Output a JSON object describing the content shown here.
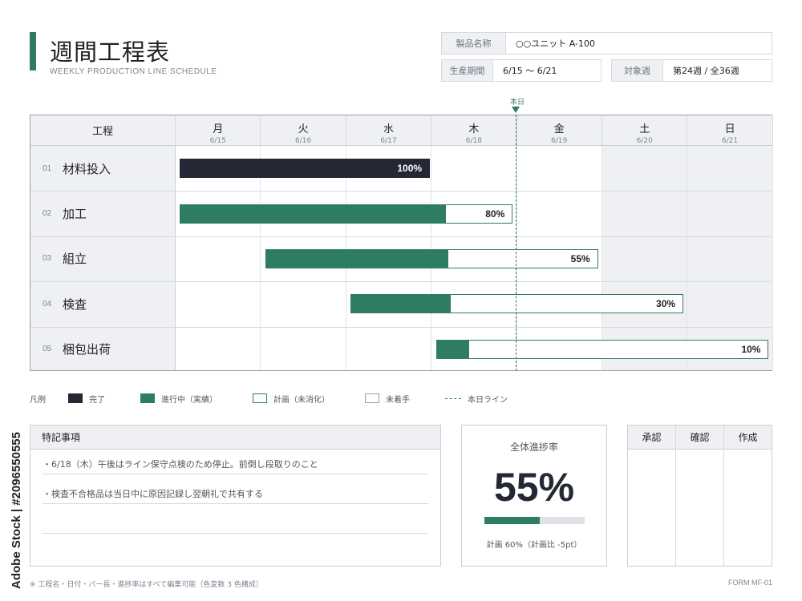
{
  "header": {
    "title": "週間工程表",
    "subtitle": "WEEKLY PRODUCTION LINE SCHEDULE"
  },
  "info": {
    "product": {
      "label": "製品名称",
      "value": "○○ユニット A-100"
    },
    "period": {
      "label": "生産期間",
      "value": "6/15 〜 6/21"
    },
    "week": {
      "label": "対象週",
      "value": "第24週 / 全36週"
    }
  },
  "today_marker": "本日",
  "gantt": {
    "process_header": "工程",
    "days": [
      {
        "day": "月",
        "date": "6/15",
        "weekend": false
      },
      {
        "day": "火",
        "date": "6/16",
        "weekend": false
      },
      {
        "day": "水",
        "date": "6/17",
        "weekend": false
      },
      {
        "day": "木",
        "date": "6/18",
        "weekend": false
      },
      {
        "day": "金",
        "date": "6/19",
        "weekend": false
      },
      {
        "day": "土",
        "date": "6/20",
        "weekend": true
      },
      {
        "day": "日",
        "date": "6/21",
        "weekend": true
      }
    ],
    "today_position_days": 3.99,
    "tasks": [
      {
        "no": "01",
        "name": "材料投入",
        "start_day": 0.05,
        "end_day": 2.98,
        "progress": 100,
        "label": "100%",
        "status": "done"
      },
      {
        "no": "02",
        "name": "加工",
        "start_day": 0.05,
        "end_day": 3.95,
        "progress": 80,
        "label": "80%",
        "status": "in-progress"
      },
      {
        "no": "03",
        "name": "組立",
        "start_day": 1.05,
        "end_day": 4.95,
        "progress": 55,
        "label": "55%",
        "status": "in-progress"
      },
      {
        "no": "04",
        "name": "検査",
        "start_day": 2.05,
        "end_day": 5.95,
        "progress": 30,
        "label": "30%",
        "status": "in-progress"
      },
      {
        "no": "05",
        "name": "梱包出荷",
        "start_day": 3.05,
        "end_day": 6.95,
        "progress": 10,
        "label": "10%",
        "status": "in-progress"
      }
    ]
  },
  "legend": {
    "title": "凡例",
    "done": "完了",
    "in_progress": "進行中（実績）",
    "plan": "計画（未消化）",
    "not_started": "未着手",
    "today_line": "本日ライン"
  },
  "notes": {
    "title": "特記事項",
    "items": [
      "・6/18（木）午後はライン保守点検のため停止。前倒し段取りのこと",
      "・検査不合格品は当日中に原因記録し翌朝礼で共有する"
    ]
  },
  "overall": {
    "title": "全体進捗率",
    "value": "55%",
    "progress": 55,
    "note": "計画 60%（計画比 -5pt）"
  },
  "approval": {
    "approve": "承認",
    "confirm": "確認",
    "create": "作成"
  },
  "footer": {
    "note": "※ 工程名・日付・バー長・進捗率はすべて編集可能（色変数 3 色構成）",
    "form": "FORM MF-01"
  },
  "watermark": "Adobe Stock | #2096550555",
  "colors": {
    "accent": "#2e7d62",
    "done": "#232834",
    "header_bg": "#eef0f3"
  }
}
